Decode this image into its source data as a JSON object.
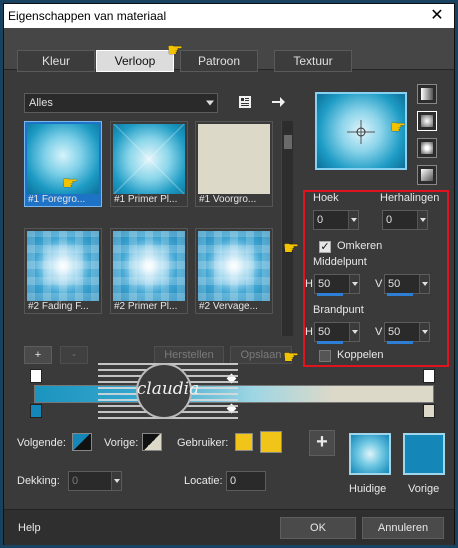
{
  "window": {
    "title": "Eigenschappen van materiaal",
    "close_glyph": "✕"
  },
  "tabs": [
    {
      "label": "Kleur",
      "active": false
    },
    {
      "label": "Verloop",
      "active": true
    },
    {
      "label": "Patroon",
      "active": false
    },
    {
      "label": "Textuur",
      "active": false
    }
  ],
  "category": {
    "selected": "Alles"
  },
  "gradients": [
    {
      "label": "#1 Foregro...",
      "style": "foreground",
      "selected": true
    },
    {
      "label": "#1 Primer Pl...",
      "style": "primary1",
      "selected": false
    },
    {
      "label": "#1 Voorgro...",
      "style": "voorgrond",
      "selected": false
    },
    {
      "label": "#2 Fading F...",
      "style": "checker",
      "selected": false
    },
    {
      "label": "#2 Primer Pl...",
      "style": "checker",
      "selected": false
    },
    {
      "label": "#2 Vervage...",
      "style": "checker",
      "selected": false
    }
  ],
  "preset_buttons": {
    "add": "+",
    "remove": "-",
    "restore": "Herstellen",
    "save": "Opslaan"
  },
  "settings": {
    "angle_label": "Hoek",
    "angle_value": "0",
    "repeats_label": "Herhalingen",
    "repeats_value": "0",
    "reverse_label": "Omkeren",
    "reverse_checked": true,
    "center_label": "Middelpunt",
    "center_h_label": "H",
    "center_h": "50",
    "center_v_label": "V",
    "center_v": "50",
    "focus_label": "Brandpunt",
    "focus_h_label": "H",
    "focus_h": "50",
    "focus_v_label": "V",
    "focus_v": "50",
    "link_label": "Koppelen",
    "link_checked": false
  },
  "lower": {
    "next_label": "Volgende:",
    "prev_label": "Vorige:",
    "user_label": "Gebruiker:",
    "opacity_label": "Dekking:",
    "opacity_value": "0",
    "location_label": "Locatie:",
    "location_value": "0",
    "add_glyph": "+"
  },
  "swatches": {
    "current_label": "Huidige",
    "previous_label": "Vorige",
    "user_color_1": "#f0c419",
    "user_color_2": "#f0c419",
    "previous_color": "#1487b8"
  },
  "footer": {
    "help": "Help",
    "ok": "OK",
    "cancel": "Annuleren"
  },
  "watermark": {
    "text": "claudia"
  },
  "colors": {
    "accent": "#1e73c6",
    "highlight": "#e0141e",
    "gradient_dark": "#1487b8",
    "gradient_light": "#dcd9c8"
  }
}
